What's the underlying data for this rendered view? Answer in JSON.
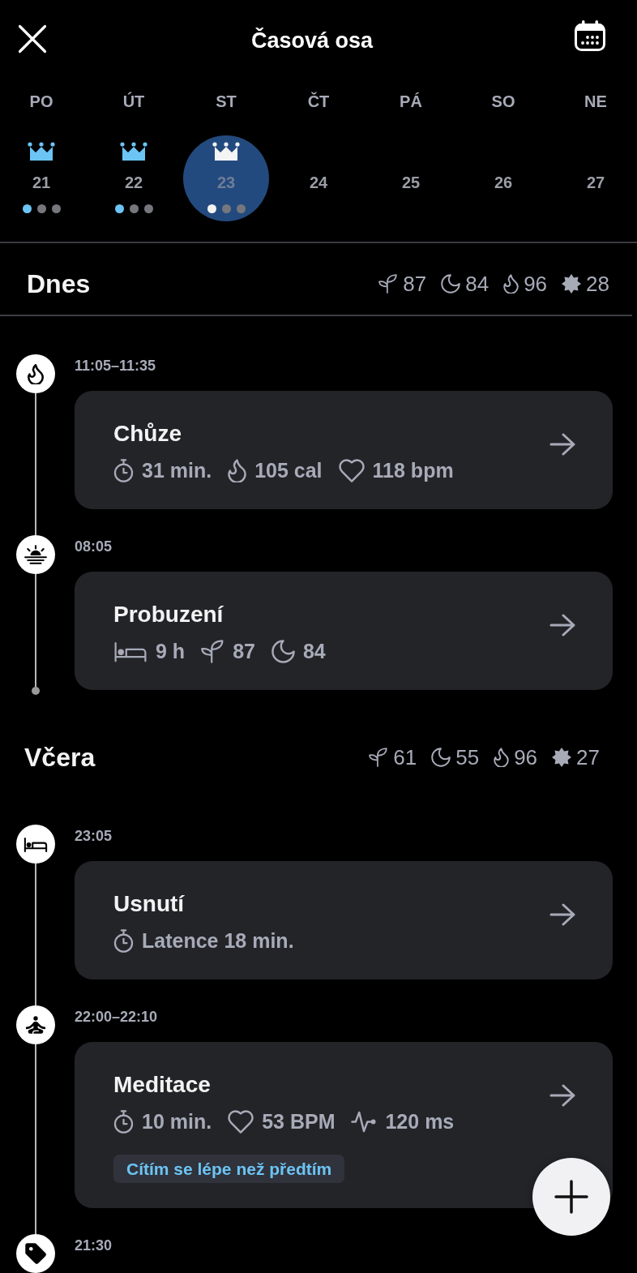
{
  "header": {
    "title": "Časová osa"
  },
  "week": [
    {
      "weekday": "PO",
      "date": "21",
      "crown": true,
      "selected": false,
      "dots": [
        {
          "color": "#6cc4f5"
        },
        {
          "color": "#75777d"
        },
        {
          "color": "#75777d"
        }
      ]
    },
    {
      "weekday": "ÚT",
      "date": "22",
      "crown": true,
      "selected": false,
      "dots": [
        {
          "color": "#6cc4f5"
        },
        {
          "color": "#75777d"
        },
        {
          "color": "#75777d"
        }
      ]
    },
    {
      "weekday": "ST",
      "date": "23",
      "crown": true,
      "selected": true,
      "dots": [
        {
          "color": "#f2f2f2"
        },
        {
          "color": "#75777d"
        },
        {
          "color": "#75777d"
        }
      ]
    },
    {
      "weekday": "ČT",
      "date": "24",
      "crown": false,
      "selected": false
    },
    {
      "weekday": "PÁ",
      "date": "25",
      "crown": false,
      "selected": false
    },
    {
      "weekday": "SO",
      "date": "26",
      "crown": false,
      "selected": false
    },
    {
      "weekday": "NE",
      "date": "27",
      "crown": false,
      "selected": false
    }
  ],
  "sections": [
    {
      "title": "Dnes",
      "pinned": true,
      "stats": [
        {
          "kind": "sprout",
          "value": "87"
        },
        {
          "kind": "moon",
          "value": "84"
        },
        {
          "kind": "flame",
          "value": "96"
        },
        {
          "kind": "star",
          "value": "28"
        }
      ],
      "events": [
        {
          "kind": "workout",
          "time": "11:05–11:35",
          "title": "Chůze",
          "metrics": [
            {
              "kind": "timer",
              "text": "31 min."
            },
            {
              "kind": "flame",
              "text": "105 cal"
            },
            {
              "kind": "heart",
              "text": "118 bpm"
            }
          ]
        },
        {
          "kind": "wake",
          "time": "08:05",
          "title": "Probuzení",
          "metrics": [
            {
              "kind": "bed",
              "text": "9 h"
            },
            {
              "kind": "sprout",
              "text": "87"
            },
            {
              "kind": "moon",
              "text": "84"
            }
          ]
        }
      ]
    },
    {
      "title": "Včera",
      "pinned": false,
      "stats": [
        {
          "kind": "sprout",
          "value": "61"
        },
        {
          "kind": "moon",
          "value": "55"
        },
        {
          "kind": "flame",
          "value": "96"
        },
        {
          "kind": "star",
          "value": "27"
        }
      ],
      "events": [
        {
          "kind": "sleep",
          "time": "23:05",
          "title": "Usnutí",
          "metrics": [
            {
              "kind": "timer",
              "text": "Latence 18 min."
            }
          ]
        },
        {
          "kind": "meditation",
          "time": "22:00–22:10",
          "title": "Meditace",
          "metrics": [
            {
              "kind": "timer",
              "text": "10 min."
            },
            {
              "kind": "heart",
              "text": "53 BPM"
            },
            {
              "kind": "pulse",
              "text": "120 ms"
            }
          ],
          "note": "Cítím se lépe než předtím"
        },
        {
          "kind": "tag",
          "time": "21:30"
        }
      ]
    }
  ]
}
